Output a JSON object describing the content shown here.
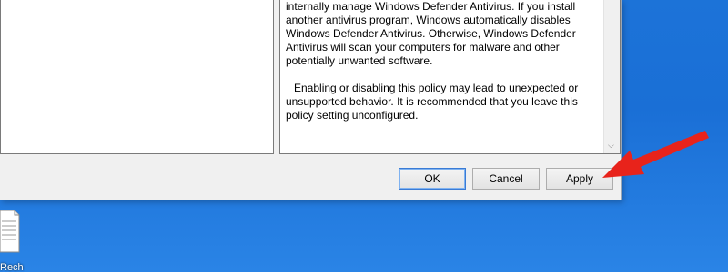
{
  "dialog": {
    "help_text": {
      "paragraph1": "internally manage Windows Defender Antivirus. If you install another antivirus program, Windows automatically disables Windows Defender Antivirus. Otherwise, Windows Defender Antivirus will scan your computers for malware and other potentially unwanted software.",
      "paragraph2": "Enabling or disabling this policy may lead to unexpected or unsupported behavior. It is recommended that you leave this policy setting unconfigured."
    },
    "buttons": {
      "ok": "OK",
      "cancel": "Cancel",
      "apply": "Apply"
    }
  },
  "desktop": {
    "icon_label": "Rech",
    "icon": "text-file-icon",
    "annotation": "red-arrow-icon"
  },
  "colors": {
    "desktop_bg": "#1a6fd6",
    "arrow": "#e8231b",
    "default_button_border": "#3a7bd5"
  }
}
